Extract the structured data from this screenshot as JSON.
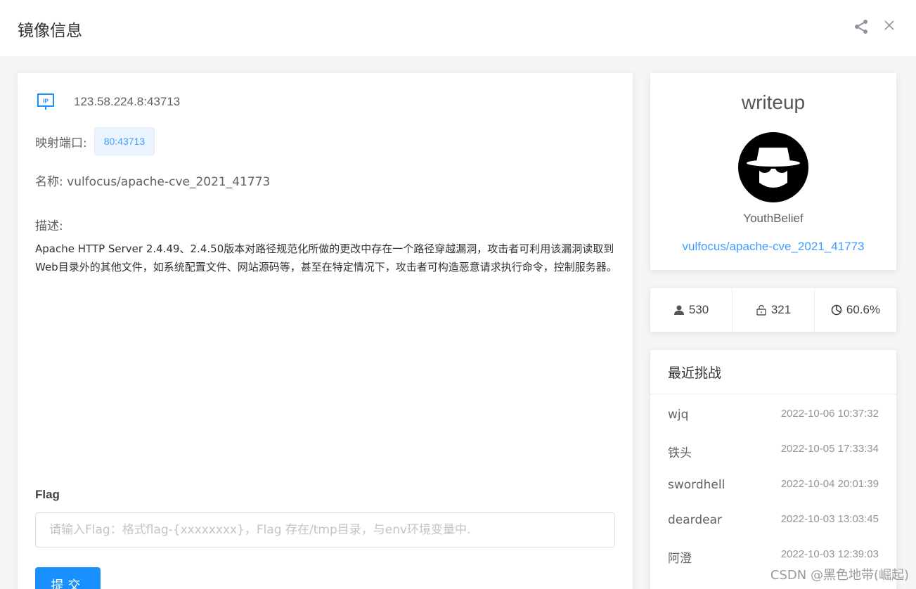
{
  "dialog": {
    "title": "镜像信息",
    "icons": {
      "share": "share-icon",
      "close": "close-icon"
    }
  },
  "main": {
    "ip_icon": "ip-icon",
    "ip": "123.58.224.8:43713",
    "port_label": "映射端口:",
    "port_value": "80:43713",
    "name": "名称: vulfocus/apache-cve_2021_41773",
    "desc_label": "描述:",
    "description": "Apache HTTP Server 2.4.49、2.4.50版本对路径规范化所做的更改中存在一个路径穿越漏洞，攻击者可利用该漏洞读取到Web目录外的其他文件，如系统配置文件、网站源码等，甚至在特定情况下，攻击者可构造恶意请求执行命令，控制服务器。",
    "flag_label": "Flag",
    "flag_value": "",
    "flag_placeholder": "请输入Flag：格式flag-{xxxxxxxx}，Flag 存在/tmp目录，与env环境变量中.",
    "submit_label": "提交"
  },
  "writeup": {
    "title": "writeup",
    "avatar_icon": "hacker-avatar-icon",
    "author": "YouthBelief",
    "link": "vulfocus/apache-cve_2021_41773"
  },
  "stats": {
    "users": "530",
    "unlocked": "321",
    "rate": "60.6%",
    "icons": {
      "users": "user-icon",
      "unlocked": "unlock-icon",
      "rate": "pie-chart-icon"
    }
  },
  "recent": {
    "title": "最近挑战",
    "items": [
      {
        "user": "wjq",
        "time": "2022-10-06 10:37:32"
      },
      {
        "user": "铁头",
        "time": "2022-10-05 17:33:34"
      },
      {
        "user": "swordhell",
        "time": "2022-10-04 20:01:39"
      },
      {
        "user": "deardear",
        "time": "2022-10-03 13:03:45"
      },
      {
        "user": "阿澄",
        "time": "2022-10-03 12:39:03"
      }
    ]
  },
  "watermark": "CSDN @黑色地带(崛起)",
  "colors": {
    "primary": "#1890ff",
    "link": "#409eff",
    "tag_bg": "#ecf5ff"
  }
}
